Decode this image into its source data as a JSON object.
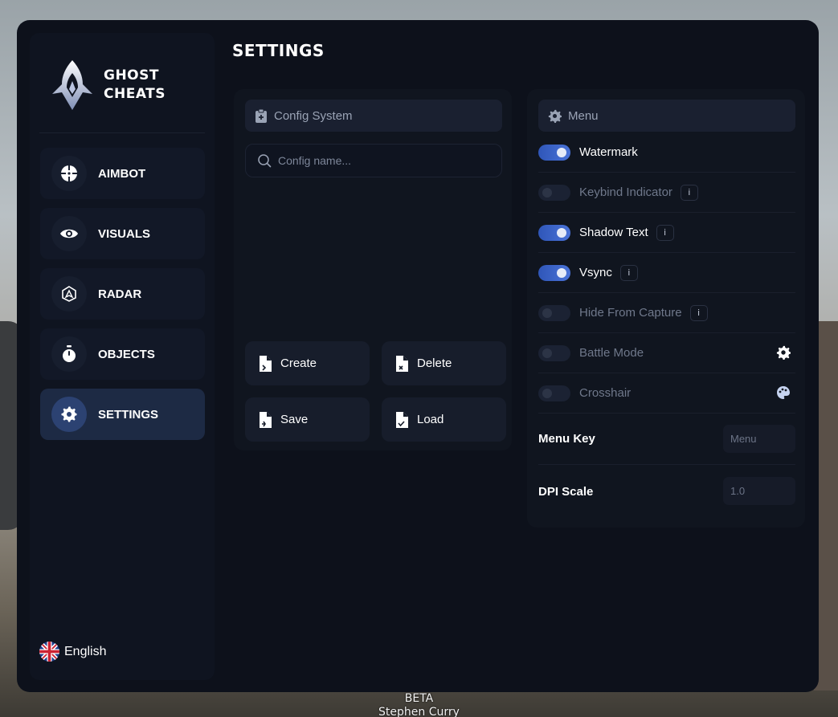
{
  "brand": {
    "line1": "GHOST",
    "line2": "CHEATS"
  },
  "sidebar": {
    "items": [
      {
        "label": "AIMBOT",
        "icon": "crosshair-icon",
        "active": false
      },
      {
        "label": "VISUALS",
        "icon": "eye-icon",
        "active": false
      },
      {
        "label": "RADAR",
        "icon": "radar-icon",
        "active": false
      },
      {
        "label": "OBJECTS",
        "icon": "timer-icon",
        "active": false
      },
      {
        "label": "SETTINGS",
        "icon": "gear-icon",
        "active": true
      }
    ],
    "language": {
      "label": "English",
      "icon": "uk-flag-icon"
    }
  },
  "page": {
    "title": "SETTINGS"
  },
  "config": {
    "header": "Config System",
    "search_placeholder": "Config name...",
    "buttons": {
      "create": "Create",
      "delete": "Delete",
      "save": "Save",
      "load": "Load"
    }
  },
  "menu": {
    "header": "Menu",
    "toggles": [
      {
        "label": "Watermark",
        "on": true,
        "info": false
      },
      {
        "label": "Keybind Indicator",
        "on": false,
        "info": true
      },
      {
        "label": "Shadow Text",
        "on": true,
        "info": true
      },
      {
        "label": "Vsync",
        "on": true,
        "info": true
      },
      {
        "label": "Hide From Capture",
        "on": false,
        "info": true
      },
      {
        "label": "Battle Mode",
        "on": false,
        "info": false,
        "right_icon": "gear-icon"
      },
      {
        "label": "Crosshair",
        "on": false,
        "info": false,
        "right_icon": "palette-icon"
      }
    ],
    "info_glyph": "i",
    "menu_key": {
      "label": "Menu Key",
      "placeholder": "Menu"
    },
    "dpi_scale": {
      "label": "DPI Scale",
      "placeholder": "1.0"
    }
  },
  "overlay": {
    "beta": "BETA",
    "name": "Stephen Curry"
  },
  "colors": {
    "accent": "#3b63c8",
    "background": "#0d111b",
    "panel": "#10151f"
  }
}
